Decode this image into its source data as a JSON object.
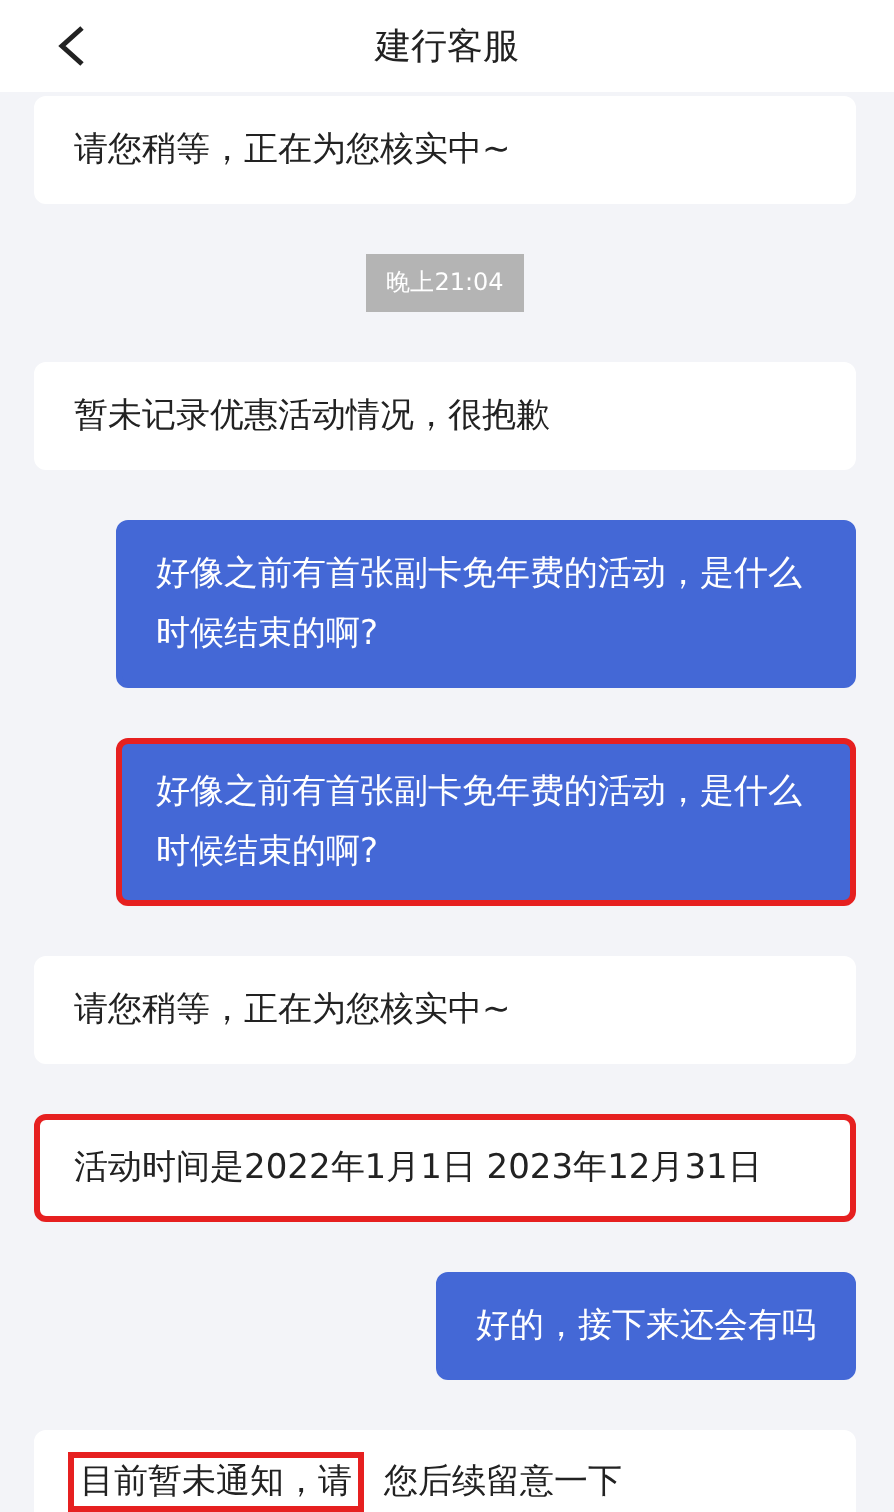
{
  "header": {
    "title": "建行客服"
  },
  "messages": [
    {
      "kind": "agent",
      "text": "请您稍等，正在为您核实中~",
      "highlighted": false
    },
    {
      "kind": "time",
      "text": "晚上21:04"
    },
    {
      "kind": "agent",
      "text": "暂未记录优惠活动情况，很抱歉",
      "highlighted": false
    },
    {
      "kind": "user",
      "text": "好像之前有首张副卡免年费的活动，是什么时候结束的啊?",
      "highlighted": false
    },
    {
      "kind": "user",
      "text": "好像之前有首张副卡免年费的活动，是什么时候结束的啊?",
      "highlighted": true
    },
    {
      "kind": "agent",
      "text": "请您稍等，正在为您核实中~",
      "highlighted": false
    },
    {
      "kind": "agent",
      "text": "活动时间是2022年1月1日 2023年12月31日",
      "highlighted": true
    },
    {
      "kind": "user",
      "text": "好的，接下来还会有吗",
      "highlighted": false
    },
    {
      "kind": "agent_parts",
      "parts": [
        {
          "text": "目前暂未通知，请",
          "highlighted": true
        },
        {
          "text": "您后续留意一下",
          "highlighted": false
        }
      ]
    }
  ]
}
